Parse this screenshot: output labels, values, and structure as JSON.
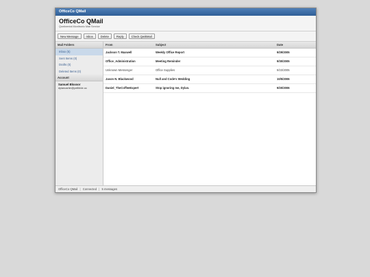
{
  "window": {
    "title": "OfficeCo QMail"
  },
  "header": {
    "app_name": "OfficeCo QMail",
    "subtitle": "Qontinental Monitronic Mail Service"
  },
  "toolbar": {
    "new_message": "New Message",
    "inbox": "Inbox",
    "delete": "Delete",
    "reply": "Reply",
    "check": "Check QwikMail"
  },
  "sidebar": {
    "folders_heading": "Mail Folders",
    "folders": [
      {
        "label": "Inbox (5)"
      },
      {
        "label": "Sent Items (0)"
      },
      {
        "label": "Drafts (0)"
      },
      {
        "label": "Deleted Items (0)"
      }
    ],
    "account_heading": "Account",
    "account_name": "Samuel Bloxsor",
    "account_email": "dylancarter@pellbble.oc"
  },
  "table": {
    "headers": {
      "from": "From",
      "subject": "Subject",
      "date": "Date"
    },
    "rows": [
      {
        "from": "Jackson T. Maxwell",
        "subject": "Weekly Office Report",
        "date": "9/29/2005",
        "unread": true
      },
      {
        "from": "Office_Administration",
        "subject": "Meeting Reminder",
        "date": "9/30/2005",
        "unread": true
      },
      {
        "from": "Unknown Messenger",
        "subject": "Office Supplies",
        "date": "9/23/2005",
        "unread": false
      },
      {
        "from": "Jason N. Blackwood",
        "subject": "Null and Code's Wedding",
        "date": "10/5/2006",
        "unread": true
      },
      {
        "from": "Daniel_TheCoffeeExpert",
        "subject": "Stop ignoring me, Dylan.",
        "date": "9/20/2006",
        "unread": true
      }
    ]
  },
  "status": {
    "app": "OfficeCo QMail",
    "separator": "|",
    "connection": "Connected",
    "count": "5 messages"
  }
}
